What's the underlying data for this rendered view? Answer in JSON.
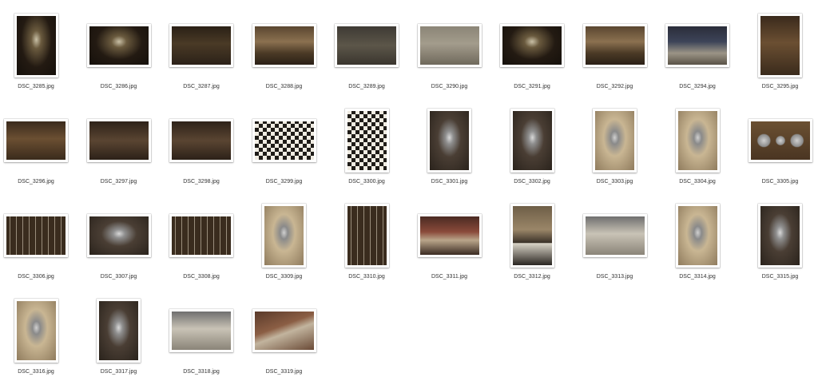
{
  "files": [
    {
      "name": "DSC_3285.jpg",
      "orientation": "portrait",
      "scene": "cabinet"
    },
    {
      "name": "DSC_3286.jpg",
      "orientation": "landscape",
      "scene": "cabinet"
    },
    {
      "name": "DSC_3287.jpg",
      "orientation": "landscape",
      "scene": "gothic"
    },
    {
      "name": "DSC_3288.jpg",
      "orientation": "landscape",
      "scene": "warm"
    },
    {
      "name": "DSC_3289.jpg",
      "orientation": "landscape",
      "scene": "stone"
    },
    {
      "name": "DSC_3290.jpg",
      "orientation": "landscape",
      "scene": "relief"
    },
    {
      "name": "DSC_3291.jpg",
      "orientation": "landscape",
      "scene": "cabinet"
    },
    {
      "name": "DSC_3292.jpg",
      "orientation": "landscape",
      "scene": "warm"
    },
    {
      "name": "DSC_3294.jpg",
      "orientation": "landscape",
      "scene": "blue"
    },
    {
      "name": "DSC_3295.jpg",
      "orientation": "portrait",
      "scene": "fire"
    },
    {
      "name": "DSC_3296.jpg",
      "orientation": "landscape",
      "scene": "fire"
    },
    {
      "name": "DSC_3297.jpg",
      "orientation": "landscape",
      "scene": "panel"
    },
    {
      "name": "DSC_3298.jpg",
      "orientation": "landscape",
      "scene": "panel"
    },
    {
      "name": "DSC_3299.jpg",
      "orientation": "landscape",
      "scene": "checker"
    },
    {
      "name": "DSC_3300.jpg",
      "orientation": "portrait",
      "scene": "checker"
    },
    {
      "name": "DSC_3301.jpg",
      "orientation": "portrait",
      "scene": "armor"
    },
    {
      "name": "DSC_3302.jpg",
      "orientation": "portrait",
      "scene": "armor"
    },
    {
      "name": "DSC_3303.jpg",
      "orientation": "portrait",
      "scene": "armorlt"
    },
    {
      "name": "DSC_3304.jpg",
      "orientation": "portrait",
      "scene": "armorlt"
    },
    {
      "name": "DSC_3305.jpg",
      "orientation": "landscape",
      "scene": "shields"
    },
    {
      "name": "DSC_3306.jpg",
      "orientation": "landscape",
      "scene": "rack"
    },
    {
      "name": "DSC_3307.jpg",
      "orientation": "landscape",
      "scene": "armor"
    },
    {
      "name": "DSC_3308.jpg",
      "orientation": "landscape",
      "scene": "rack"
    },
    {
      "name": "DSC_3309.jpg",
      "orientation": "portrait",
      "scene": "armorlt"
    },
    {
      "name": "DSC_3310.jpg",
      "orientation": "portrait",
      "scene": "rack"
    },
    {
      "name": "DSC_3311.jpg",
      "orientation": "landscape",
      "scene": "red"
    },
    {
      "name": "DSC_3312.jpg",
      "orientation": "portrait",
      "scene": "hall"
    },
    {
      "name": "DSC_3313.jpg",
      "orientation": "landscape",
      "scene": "pale"
    },
    {
      "name": "DSC_3314.jpg",
      "orientation": "portrait",
      "scene": "armorlt"
    },
    {
      "name": "DSC_3315.jpg",
      "orientation": "portrait",
      "scene": "armor"
    },
    {
      "name": "DSC_3316.jpg",
      "orientation": "portrait",
      "scene": "armorlt"
    },
    {
      "name": "DSC_3317.jpg",
      "orientation": "portrait",
      "scene": "armor"
    },
    {
      "name": "DSC_3318.jpg",
      "orientation": "landscape",
      "scene": "pale"
    },
    {
      "name": "DSC_3319.jpg",
      "orientation": "landscape",
      "scene": "weapons"
    }
  ]
}
